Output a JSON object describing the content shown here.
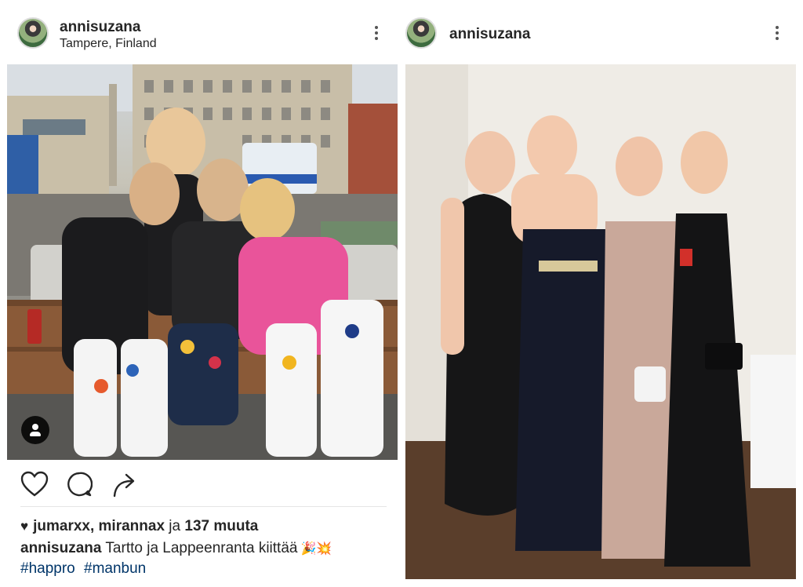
{
  "left_post": {
    "username": "annisuzana",
    "location": "Tampere, Finland",
    "photo_alt": "",
    "likes": {
      "users": "jumarxx, mirannax",
      "conjunction": "ja",
      "others": "137 muuta"
    },
    "caption": {
      "username": "annisuzana",
      "text": "Tartto ja Lappeenranta kiittää",
      "emoji": "🎉💥"
    },
    "hashtags": [
      "#happro",
      "#manbun"
    ],
    "icons": {
      "more": "more-vertical-icon",
      "like": "heart-outline-icon",
      "comment": "comment-bubble-icon",
      "share": "share-arrow-icon",
      "user_tag": "user-tag-icon"
    }
  },
  "right_post": {
    "username": "annisuzana",
    "icons": {
      "more": "more-vertical-icon"
    }
  },
  "colors": {
    "text": "#262626",
    "hashtag": "#003569",
    "background": "#ffffff"
  }
}
